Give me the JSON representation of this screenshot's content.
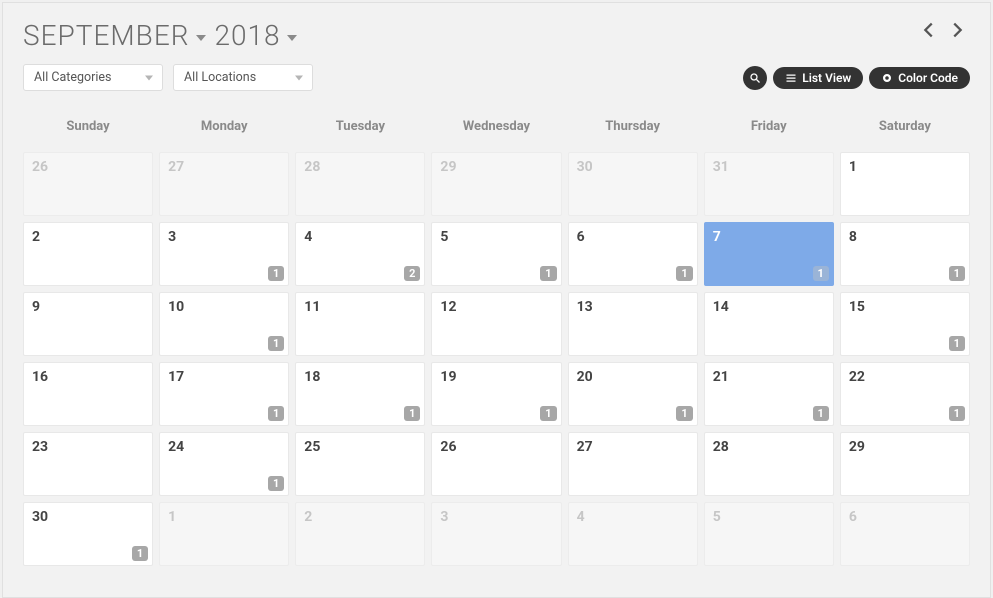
{
  "header": {
    "month": "September",
    "year": "2018"
  },
  "filters": {
    "category_label": "All Categories",
    "location_label": "All Locations"
  },
  "actions": {
    "list_view": "List View",
    "color_code": "Color Code"
  },
  "daynames": [
    "Sunday",
    "Monday",
    "Tuesday",
    "Wednesday",
    "Thursday",
    "Friday",
    "Saturday"
  ],
  "weeks": [
    [
      {
        "num": "26",
        "other": true
      },
      {
        "num": "27",
        "other": true
      },
      {
        "num": "28",
        "other": true
      },
      {
        "num": "29",
        "other": true
      },
      {
        "num": "30",
        "other": true
      },
      {
        "num": "31",
        "other": true
      },
      {
        "num": "1"
      }
    ],
    [
      {
        "num": "2"
      },
      {
        "num": "3",
        "badge": "1"
      },
      {
        "num": "4",
        "badge": "2"
      },
      {
        "num": "5",
        "badge": "1"
      },
      {
        "num": "6",
        "badge": "1"
      },
      {
        "num": "7",
        "badge": "1",
        "today": true
      },
      {
        "num": "8",
        "badge": "1"
      }
    ],
    [
      {
        "num": "9"
      },
      {
        "num": "10",
        "badge": "1"
      },
      {
        "num": "11"
      },
      {
        "num": "12"
      },
      {
        "num": "13"
      },
      {
        "num": "14"
      },
      {
        "num": "15",
        "badge": "1"
      }
    ],
    [
      {
        "num": "16"
      },
      {
        "num": "17",
        "badge": "1"
      },
      {
        "num": "18",
        "badge": "1"
      },
      {
        "num": "19",
        "badge": "1"
      },
      {
        "num": "20",
        "badge": "1"
      },
      {
        "num": "21",
        "badge": "1"
      },
      {
        "num": "22",
        "badge": "1"
      }
    ],
    [
      {
        "num": "23"
      },
      {
        "num": "24",
        "badge": "1"
      },
      {
        "num": "25"
      },
      {
        "num": "26"
      },
      {
        "num": "27"
      },
      {
        "num": "28"
      },
      {
        "num": "29"
      }
    ],
    [
      {
        "num": "30",
        "badge": "1"
      },
      {
        "num": "1",
        "other": true
      },
      {
        "num": "2",
        "other": true
      },
      {
        "num": "3",
        "other": true
      },
      {
        "num": "4",
        "other": true
      },
      {
        "num": "5",
        "other": true
      },
      {
        "num": "6",
        "other": true
      }
    ]
  ]
}
